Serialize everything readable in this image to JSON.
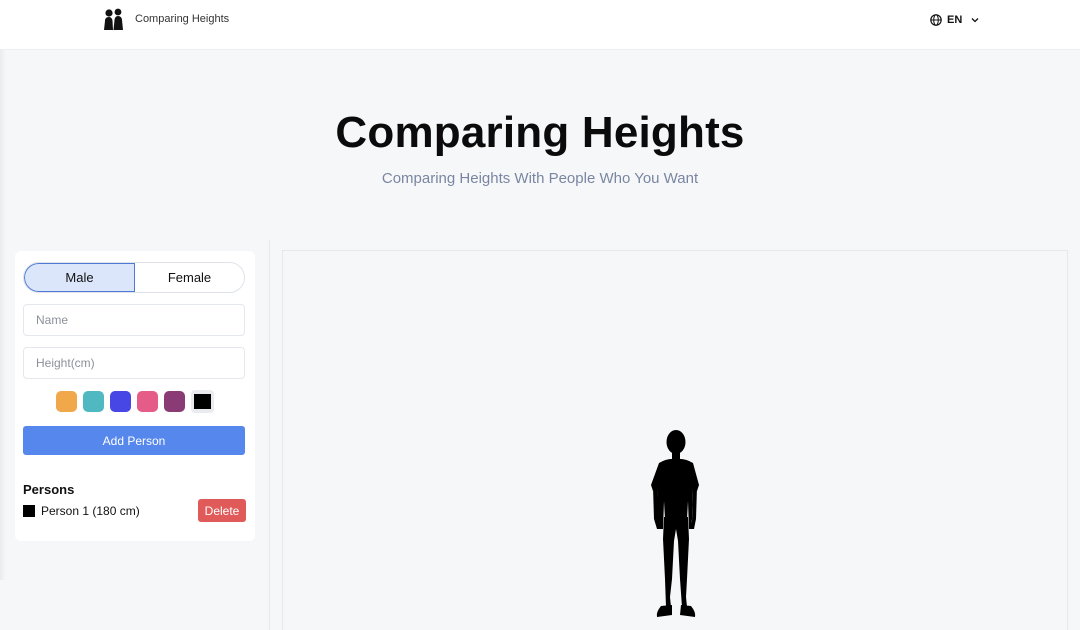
{
  "header": {
    "brand": "Comparing Heights",
    "logo_icon": "two-people-icon",
    "language": "EN",
    "language_icon": "globe-icon",
    "dropdown_icon": "chevron-down-icon"
  },
  "hero": {
    "title": "Comparing Heights",
    "subtitle": "Comparing Heights With People Who You Want"
  },
  "form": {
    "gender_options": [
      "Male",
      "Female"
    ],
    "selected_gender": "Male",
    "name_placeholder": "Name",
    "height_placeholder": "Height(cm)",
    "colors": [
      "#f0a84a",
      "#4fb8c0",
      "#4747e6",
      "#e45c87",
      "#8a3a74",
      "#000000"
    ],
    "selected_color": "#000000",
    "add_button": "Add Person"
  },
  "persons": {
    "title": "Persons",
    "items": [
      {
        "label": "Person 1 (180 cm)",
        "color": "#000000",
        "delete_label": "Delete"
      }
    ]
  },
  "canvas": {
    "figures": [
      {
        "type": "male-silhouette-icon",
        "height_cm": 180,
        "color": "#000000"
      }
    ]
  }
}
